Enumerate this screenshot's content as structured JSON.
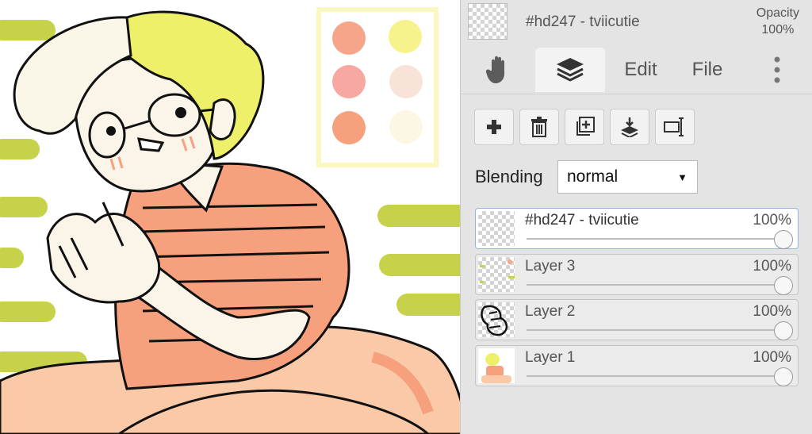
{
  "document": {
    "title": "#hd247 - tviicutie",
    "opacity_label": "Opacity",
    "opacity_value": "100%"
  },
  "tabs": [
    {
      "id": "hand",
      "icon": "hand-icon"
    },
    {
      "id": "layers",
      "icon": "layers-icon",
      "active": true
    },
    {
      "id": "edit",
      "label": "Edit"
    },
    {
      "id": "file",
      "label": "File"
    },
    {
      "id": "more",
      "icon": "more-vertical-icon"
    }
  ],
  "toolbar": [
    "add-layer-icon",
    "delete-layer-icon",
    "duplicate-layer-icon",
    "merge-down-icon",
    "rename-layer-icon"
  ],
  "blending": {
    "label": "Blending",
    "value": "normal"
  },
  "layers": [
    {
      "name": "#hd247 - tviicutie",
      "opacity": "100%",
      "opacity_value": 1.0,
      "selected": true
    },
    {
      "name": "Layer 3",
      "opacity": "100%",
      "opacity_value": 1.0
    },
    {
      "name": "Layer 2",
      "opacity": "100%",
      "opacity_value": 1.0
    },
    {
      "name": "Layer 1",
      "opacity": "100%",
      "opacity_value": 1.0
    }
  ],
  "palette": [
    "#f7a58a",
    "#f7f38c",
    "#f7a8a0",
    "#f7e3d8",
    "#f7a07e",
    "#fbf7e4"
  ],
  "colors": {
    "stripe": "#c6d24a",
    "skin": "#fbf4e8",
    "shirt": "#f7a07e",
    "hair": "#eef06a",
    "selection": "#8fb4dd"
  }
}
